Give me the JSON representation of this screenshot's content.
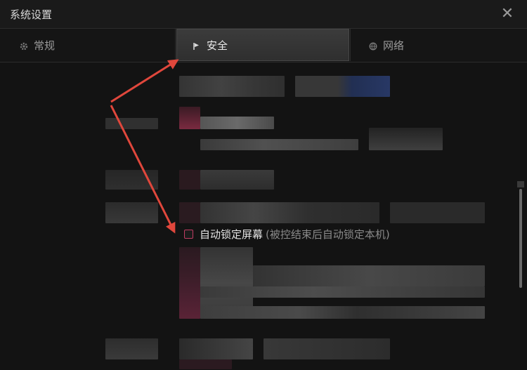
{
  "window": {
    "title": "系统设置",
    "close_icon": "close-icon"
  },
  "tabs": [
    {
      "label": "常规",
      "icon": "gear-icon",
      "active": false
    },
    {
      "label": "安全",
      "icon": "flag-icon",
      "active": true
    },
    {
      "label": "网络",
      "icon": "globe-icon",
      "active": false
    }
  ],
  "security": {
    "auto_lock": {
      "label": "自动锁定屏幕",
      "hint": "(被控结束后自动锁定本机)",
      "checked": false
    }
  },
  "colors": {
    "accent": "#c03c63",
    "arrow": "#e0473c",
    "background": "#131313"
  }
}
